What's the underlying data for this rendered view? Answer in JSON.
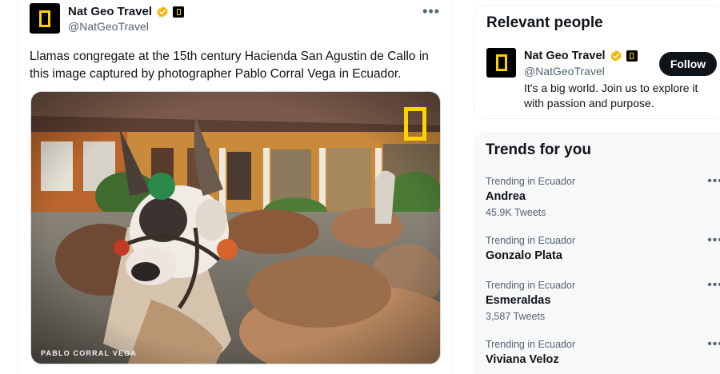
{
  "tweet": {
    "author_name": "Nat Geo Travel",
    "author_handle": "@NatGeoTravel",
    "more_icon": "more-horizontal-icon",
    "text": "Llamas congregate at the 15th century Hacienda San Agustin de Callo in this image captured by photographer Pablo Corral Vega in Ecuador.",
    "media": {
      "credit": "PABLO CORRAL VEGA",
      "subject": "llamas-photo"
    }
  },
  "relevant_people": {
    "title": "Relevant people",
    "person": {
      "name": "Nat Geo Travel",
      "handle": "@NatGeoTravel",
      "bio": "It's a big world. Join us to explore it with passion and purpose.",
      "follow_label": "Follow"
    }
  },
  "trends": {
    "title": "Trends for you",
    "items": [
      {
        "context": "Trending in Ecuador",
        "name": "Andrea",
        "count": "45.9K Tweets"
      },
      {
        "context": "Trending in Ecuador",
        "name": "Gonzalo Plata",
        "count": ""
      },
      {
        "context": "Trending in Ecuador",
        "name": "Esmeraldas",
        "count": "3,587 Tweets"
      },
      {
        "context": "Trending in Ecuador",
        "name": "Viviana Veloz",
        "count": ""
      }
    ]
  },
  "colors": {
    "verified_gold": "#f4b400",
    "brand_yellow": "#ffd200",
    "text_primary": "#0f1419",
    "text_secondary": "#536471"
  }
}
